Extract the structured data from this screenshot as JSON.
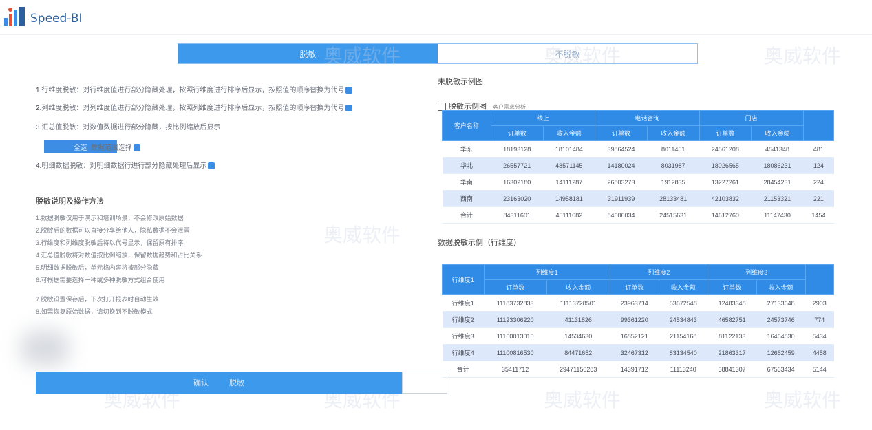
{
  "app": {
    "brand": "Speed-BI"
  },
  "tabs": [
    {
      "label": "脱敏",
      "active": true
    },
    {
      "label": "不脱敏",
      "active": false
    }
  ],
  "left": {
    "options": [
      {
        "num": "1.",
        "text": "行维度脱敏：对行维度值进行部分隐藏处理，按照行维度进行排序后显示，按照值的顺序替换为代号"
      },
      {
        "num": "2.",
        "text": "列维度脱敏：对列维度值进行部分隐藏处理，按照列维度进行排序后显示，按照值的顺序替换为代号"
      },
      {
        "num": "3.",
        "text": "汇总值脱敏：对数值数据进行部分隐藏，按比例缩放后显示"
      },
      {
        "num": "4.",
        "text": "明细数据脱敏：对明细数据行进行部分隐藏处理后显示"
      }
    ],
    "select_button": "全选",
    "select_label": "数据范围选择",
    "notes_title": "脱敏说明及操作方法",
    "notes": [
      "1.数据脱敏仅用于演示和培训场景，不会修改原始数据",
      "2.脱敏后的数据可以直接分享给他人，隐私数据不会泄露",
      "3.行维度和列维度脱敏后将以代号显示，保留原有排序",
      "4.汇总值脱敏将对数值按比例缩放，保留数据趋势和占比关系",
      "5.明细数据脱敏后，单元格内容将被部分隐藏",
      "6.可根据需要选择一种或多种脱敏方式组合使用",
      "7.脱敏设置保存后，下次打开报表时自动生效",
      "8.如需恢复原始数据，请切换到不脱敏模式"
    ],
    "bottom_button": {
      "left": "确认",
      "right": "脱敏"
    }
  },
  "right": {
    "label1": "未脱敏示例图",
    "label2": "脱敏示例图",
    "chk_caption": "客户需求分析",
    "table1": {
      "headers_top": [
        "客户名称",
        "线上",
        "",
        "电话咨询",
        "",
        "门店",
        ""
      ],
      "headers_sub": [
        "",
        "订单数",
        "收入金额",
        "订单数",
        "收入金额",
        "订单数",
        "收入金额",
        ""
      ],
      "rows": [
        [
          "华东",
          "18193128",
          "18101484",
          "39864524",
          "8011451",
          "24561208",
          "4541348",
          "481"
        ],
        [
          "华北",
          "26557721",
          "48571145",
          "14180024",
          "8031987",
          "18026565",
          "18086231",
          "124"
        ],
        [
          "华南",
          "16302180",
          "14111287",
          "26803273",
          "1912835",
          "13227261",
          "28454231",
          "224"
        ],
        [
          "西南",
          "23163020",
          "14958181",
          "31911939",
          "28133481",
          "42103832",
          "21153321",
          "221"
        ],
        [
          "合计",
          "84311601",
          "45111082",
          "84606034",
          "24515631",
          "14612760",
          "11147430",
          "1454"
        ]
      ]
    },
    "label3": "数据脱敏示例（行维度）",
    "table2": {
      "headers_top": [
        "行维度1",
        "列维度1",
        "",
        "列维度2",
        "",
        "列维度3",
        ""
      ],
      "headers_sub": [
        "",
        "订单数",
        "收入金额",
        "订单数",
        "收入金额",
        "订单数",
        "收入金额",
        ""
      ],
      "rows": [
        [
          "行维度1",
          "11183732833",
          "11113728501",
          "23963714",
          "53672548",
          "12483348",
          "27133648",
          "2903"
        ],
        [
          "行维度2",
          "11123306220",
          "41131826",
          "99361220",
          "24534843",
          "46582751",
          "24573746",
          "774"
        ],
        [
          "行维度3",
          "11160013010",
          "14534630",
          "16852121",
          "21154168",
          "81122133",
          "16464830",
          "5434"
        ],
        [
          "行维度4",
          "11100816530",
          "84471652",
          "32467312",
          "83134540",
          "21863317",
          "12662459",
          "4458"
        ],
        [
          "合计",
          "35411712",
          "29471150283",
          "14391712",
          "11113240",
          "58841307",
          "67563434",
          "5144"
        ]
      ]
    }
  },
  "watermark": "奥威软件"
}
